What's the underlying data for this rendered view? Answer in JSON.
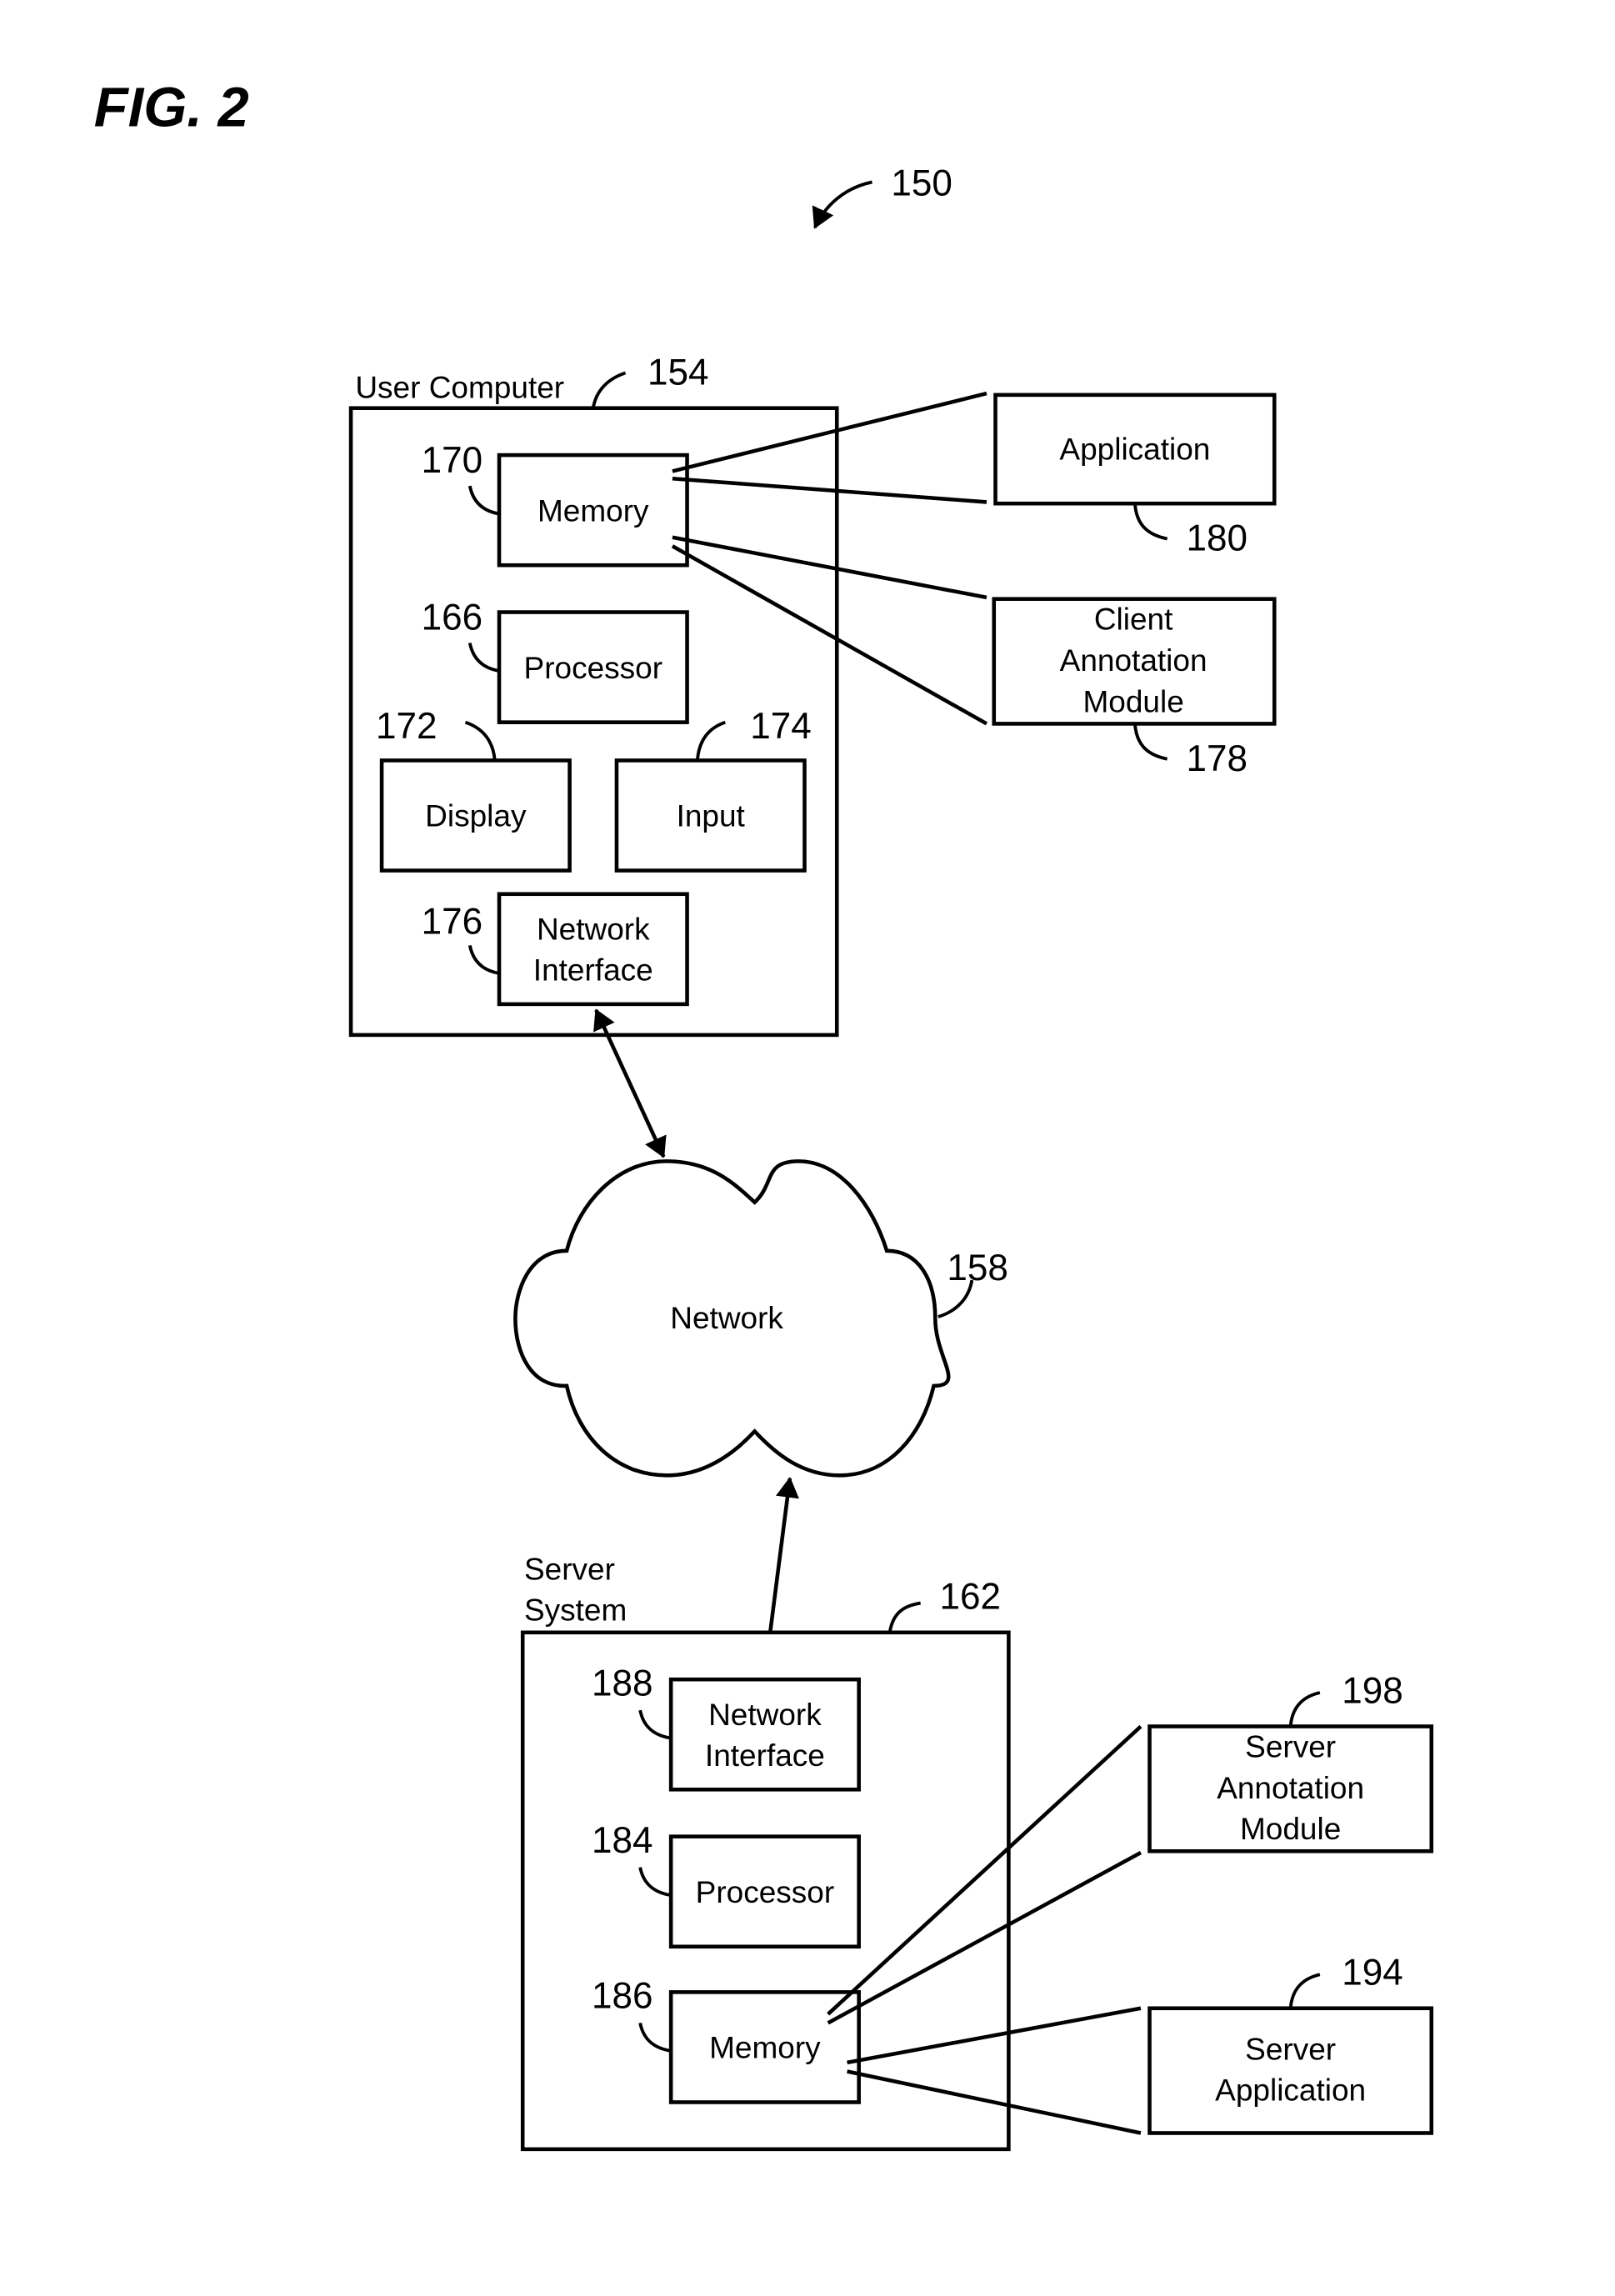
{
  "figure": {
    "title": "FIG. 2",
    "ref": "150"
  },
  "user_computer": {
    "label": "User Computer",
    "ref": "154",
    "memory": {
      "label": "Memory",
      "ref": "170"
    },
    "processor": {
      "label": "Processor",
      "ref": "166"
    },
    "display": {
      "label": "Display",
      "ref": "172"
    },
    "input": {
      "label": "Input",
      "ref": "174"
    },
    "network_interface": {
      "line1": "Network",
      "line2": "Interface",
      "ref": "176"
    }
  },
  "application": {
    "label": "Application",
    "ref": "180"
  },
  "client_annotation_module": {
    "line1": "Client",
    "line2": "Annotation",
    "line3": "Module",
    "ref": "178"
  },
  "network": {
    "label": "Network",
    "ref": "158"
  },
  "server_system": {
    "line1": "Server",
    "line2": "System",
    "ref": "162",
    "network_interface": {
      "line1": "Network",
      "line2": "Interface",
      "ref": "188"
    },
    "processor": {
      "label": "Processor",
      "ref": "184"
    },
    "memory": {
      "label": "Memory",
      "ref": "186"
    }
  },
  "server_annotation_module": {
    "line1": "Server",
    "line2": "Annotation",
    "line3": "Module",
    "ref": "198"
  },
  "server_application": {
    "line1": "Server",
    "line2": "Application",
    "ref": "194"
  }
}
